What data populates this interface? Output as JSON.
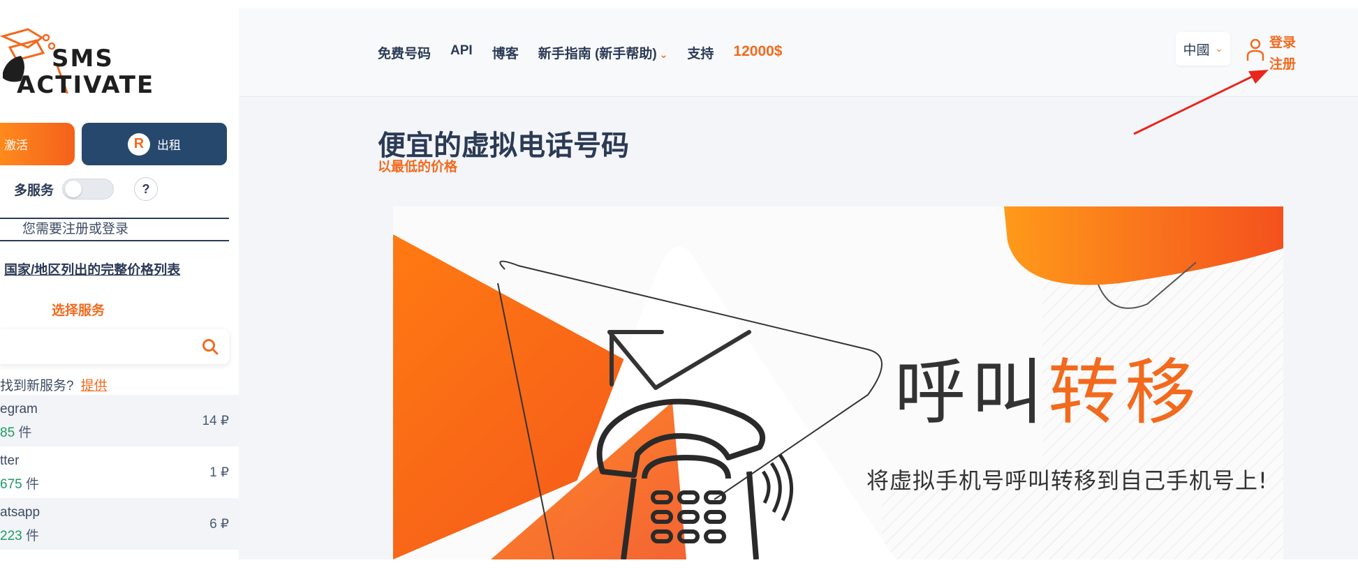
{
  "logo": {
    "line1": "SMS",
    "line2": "ACTIVATE"
  },
  "sidebar": {
    "activate_label": "激活",
    "rent_label": "出租",
    "multi_service_label": "多服务",
    "help_label": "?",
    "login_note": "您需要注册或登录",
    "price_list_link": "国家/地区列出的完整价格列表",
    "choose_service": "选择服务",
    "search_placeholder": "",
    "suggest_text": "找到新服务?",
    "suggest_link": "提供",
    "services": [
      {
        "name": "egram",
        "count": "85",
        "unit": "件",
        "price": "14 ₽"
      },
      {
        "name": "tter",
        "count": "675",
        "unit": "件",
        "price": "1 ₽"
      },
      {
        "name": "atsapp",
        "count": "223",
        "unit": "件",
        "price": "6 ₽"
      }
    ]
  },
  "nav": {
    "items": [
      "免费号码",
      "API",
      "博客",
      "新手指南 (新手帮助)",
      "支持"
    ],
    "bonus": "12000$",
    "lang": "中國",
    "login": "登录",
    "register": "注册"
  },
  "hero": {
    "title": "便宜的虚拟电话号码",
    "subtitle": "以最低的价格"
  },
  "banner": {
    "title_part1": "呼叫",
    "title_part2": "转移",
    "subtitle": "将虚拟手机号呼叫转移到自己手机号上!"
  },
  "colors": {
    "accent": "#f26a1e",
    "navy": "#27486d",
    "text": "#2b3a55",
    "count_green": "#1f9a63"
  },
  "icons": [
    "logo-icon",
    "rent-logo-icon",
    "search-icon",
    "chevron-down-icon",
    "user-icon",
    "annotation-arrow-icon",
    "phone-icon",
    "envelope-icon"
  ]
}
